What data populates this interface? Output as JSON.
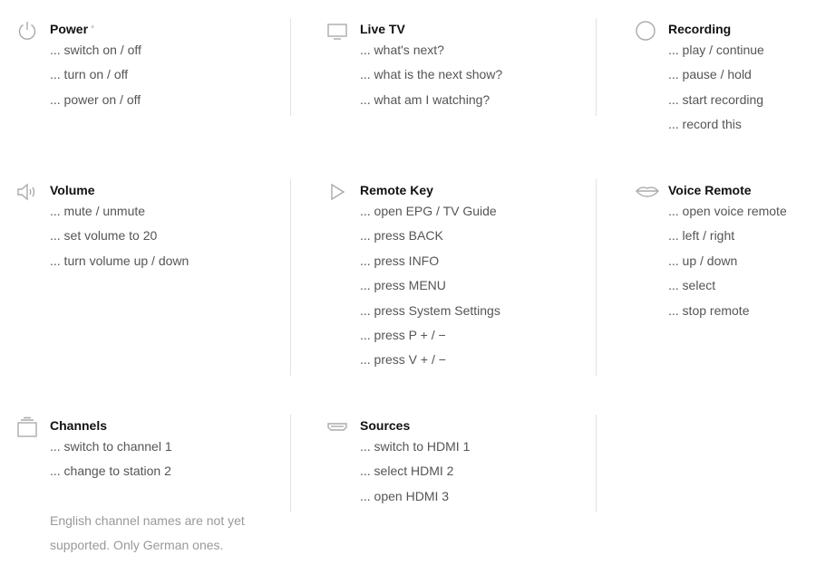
{
  "sections": [
    {
      "title": "Power",
      "marker": "*",
      "icon": "power-icon",
      "items": [
        "... switch on / off",
        "... turn on / off",
        "... power on / off"
      ]
    },
    {
      "title": "Live TV",
      "icon": "tv-icon",
      "items": [
        "... what's next?",
        "... what is the next show?",
        "... what am I watching?"
      ]
    },
    {
      "title": "Recording",
      "icon": "record-circle-icon",
      "items": [
        "... play / continue",
        "... pause / hold",
        "... start recording",
        "... record this"
      ]
    },
    {
      "title": "Volume",
      "icon": "speaker-icon",
      "items": [
        "... mute / unmute",
        "... set volume to 20",
        "... turn volume up / down"
      ]
    },
    {
      "title": "Remote Key",
      "icon": "play-triangle-icon",
      "items": [
        "... open EPG / TV Guide",
        "... press BACK",
        "... press INFO",
        "... press MENU",
        "... press System Settings",
        "... press P + / −",
        "... press V + / −"
      ]
    },
    {
      "title": "Voice Remote",
      "icon": "lips-icon",
      "items": [
        "... open voice remote",
        "... left / right",
        "... up / down",
        "... select",
        "... stop remote"
      ]
    },
    {
      "title": "Channels",
      "icon": "channels-stack-icon",
      "items": [
        "... switch to channel 1",
        "... change to station 2"
      ],
      "note": "English channel names are not yet supported. Only German ones."
    },
    {
      "title": "Sources",
      "icon": "hdmi-port-icon",
      "items": [
        "... switch to HDMI 1",
        "... select HDMI 2",
        "... open HDMI 3"
      ]
    }
  ]
}
